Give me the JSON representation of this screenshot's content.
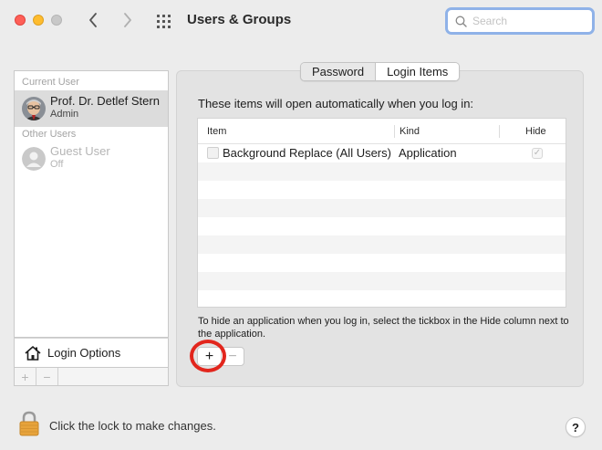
{
  "window": {
    "title": "Users & Groups"
  },
  "search": {
    "placeholder": "Search",
    "value": ""
  },
  "sidebar": {
    "current_user_label": "Current User",
    "current_user": {
      "name": "Prof. Dr. Detlef Stern",
      "role": "Admin"
    },
    "other_users_label": "Other Users",
    "other_users": [
      {
        "name": "Guest User",
        "status": "Off"
      }
    ],
    "login_options_label": "Login Options",
    "add_symbol": "+",
    "remove_symbol": "−"
  },
  "tabs": [
    {
      "label": "Password",
      "active": false
    },
    {
      "label": "Login Items",
      "active": true
    }
  ],
  "login_items": {
    "description": "These items will open automatically when you log in:",
    "columns": {
      "item": "Item",
      "kind": "Kind",
      "hide": "Hide"
    },
    "rows": [
      {
        "item": "Background Replace (All Users)",
        "kind": "Application",
        "hide": true,
        "hide_mark": "✓"
      }
    ],
    "hint": "To hide an application when you log in, select the tickbox in the Hide column next to the application.",
    "add_symbol": "+",
    "remove_symbol": "−"
  },
  "footer": {
    "lock_text": "Click the lock to make changes.",
    "help_symbol": "?"
  },
  "colors": {
    "close": "#fe5f57",
    "minimize": "#febc2e",
    "search_focus": "#8fb2e8",
    "highlight_ring": "#e2261d"
  }
}
